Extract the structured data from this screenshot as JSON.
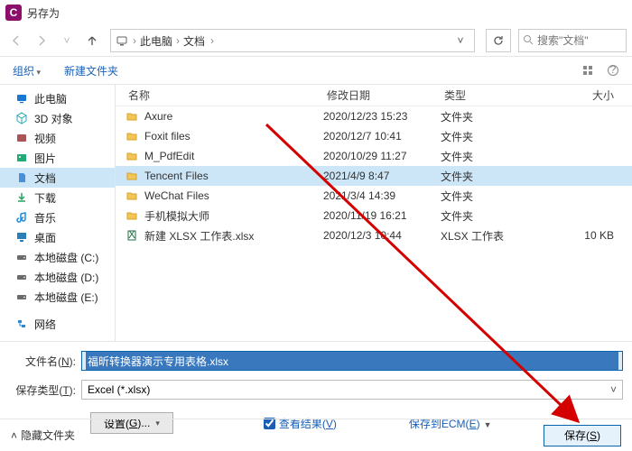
{
  "window": {
    "title": "另存为",
    "app_letter": "C"
  },
  "nav": {
    "breadcrumb": [
      "此电脑",
      "文档"
    ],
    "search_placeholder": "搜索\"文档\""
  },
  "toolbar": {
    "organize": "组织",
    "new_folder": "新建文件夹"
  },
  "sidebar": {
    "items": [
      {
        "label": "此电脑",
        "icon": "pc-icon",
        "cls": "i-pc"
      },
      {
        "label": "3D 对象",
        "icon": "cube-icon",
        "cls": "i-3d"
      },
      {
        "label": "视频",
        "icon": "video-icon",
        "cls": "i-vid"
      },
      {
        "label": "图片",
        "icon": "picture-icon",
        "cls": "i-img"
      },
      {
        "label": "文档",
        "icon": "document-icon",
        "cls": "i-doc",
        "selected": true
      },
      {
        "label": "下载",
        "icon": "download-icon",
        "cls": "i-dl"
      },
      {
        "label": "音乐",
        "icon": "music-icon",
        "cls": "i-mus"
      },
      {
        "label": "桌面",
        "icon": "desktop-icon",
        "cls": "i-desk"
      },
      {
        "label": "本地磁盘 (C:)",
        "icon": "disk-icon",
        "cls": "i-disk"
      },
      {
        "label": "本地磁盘 (D:)",
        "icon": "disk-icon",
        "cls": "i-disk"
      },
      {
        "label": "本地磁盘 (E:)",
        "icon": "disk-icon",
        "cls": "i-disk"
      },
      {
        "label": "",
        "sep": true
      },
      {
        "label": "网络",
        "icon": "network-icon",
        "cls": "i-net"
      }
    ]
  },
  "filelist": {
    "columns": {
      "name": "名称",
      "date": "修改日期",
      "type": "类型",
      "size": "大小"
    },
    "rows": [
      {
        "name": "Axure",
        "date": "2020/12/23 15:23",
        "type": "文件夹",
        "size": "",
        "kind": "folder"
      },
      {
        "name": "Foxit files",
        "date": "2020/12/7 10:41",
        "type": "文件夹",
        "size": "",
        "kind": "folder"
      },
      {
        "name": "M_PdfEdit",
        "date": "2020/10/29 11:27",
        "type": "文件夹",
        "size": "",
        "kind": "folder"
      },
      {
        "name": "Tencent Files",
        "date": "2021/4/9 8:47",
        "type": "文件夹",
        "size": "",
        "kind": "folder",
        "selected": true
      },
      {
        "name": "WeChat Files",
        "date": "2021/3/4 14:39",
        "type": "文件夹",
        "size": "",
        "kind": "folder"
      },
      {
        "name": "手机模拟大师",
        "date": "2020/11/19 16:21",
        "type": "文件夹",
        "size": "",
        "kind": "folder"
      },
      {
        "name": "新建 XLSX 工作表.xlsx",
        "date": "2020/12/3 10:44",
        "type": "XLSX 工作表",
        "size": "10 KB",
        "kind": "xlsx"
      }
    ]
  },
  "form": {
    "filename_label_pre": "文件名(",
    "filename_label_u": "N",
    "filename_label_post": "):",
    "filename_value": "福昕转换器演示专用表格.xlsx",
    "filetype_label_pre": "保存类型(",
    "filetype_label_u": "T",
    "filetype_label_post": "):",
    "filetype_value": "Excel (*.xlsx)",
    "settings_btn_pre": "设置(",
    "settings_btn_u": "G",
    "settings_btn_post": ")...",
    "view_result_pre": "查看结果(",
    "view_result_u": "V",
    "view_result_post": ")",
    "save_ecm_pre": "保存到ECM(",
    "save_ecm_u": "E",
    "save_ecm_post": ")"
  },
  "footer": {
    "hide_folders": "隐藏文件夹",
    "save_btn_pre": "保存(",
    "save_btn_u": "S",
    "save_btn_post": ")"
  }
}
